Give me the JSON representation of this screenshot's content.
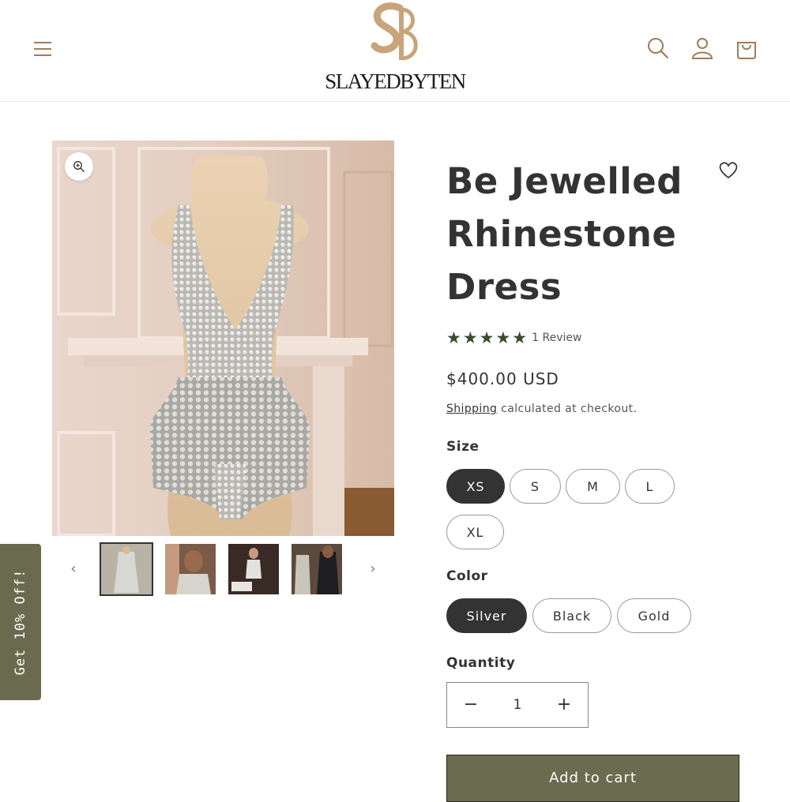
{
  "header": {
    "brand_name": "SLAYEDBYTEN",
    "brand_mark": "SB",
    "icons": {
      "menu": "hamburger-menu-icon",
      "search": "search-icon",
      "account": "account-icon",
      "cart": "cart-icon"
    }
  },
  "promo_tab": {
    "label": "Get 10% Off!"
  },
  "gallery": {
    "thumbnails": [
      "thumbnail-1",
      "thumbnail-2",
      "thumbnail-3",
      "thumbnail-4"
    ],
    "prev": "‹",
    "next": "›"
  },
  "product": {
    "title": "Be Jewelled Rhinestone Dress",
    "rating": {
      "stars": 5,
      "star_glyphs": "★★★★★",
      "review_text": "1 Review"
    },
    "price": "$400.00 USD",
    "shipping_link": "Shipping",
    "shipping_rest": " calculated at checkout.",
    "size": {
      "label": "Size",
      "options": [
        "XS",
        "S",
        "M",
        "L",
        "XL"
      ],
      "selected": "XS"
    },
    "color": {
      "label": "Color",
      "options": [
        "Silver",
        "Black",
        "Gold"
      ],
      "selected": "Silver"
    },
    "quantity": {
      "label": "Quantity",
      "value": "1",
      "minus": "−",
      "plus": "+"
    },
    "add_to_cart": "Add to cart"
  },
  "colors": {
    "accent": "#6b6b4f",
    "star": "#3c4a2c",
    "logo_gold": "#c8a47a",
    "selected_pill": "#333333"
  }
}
